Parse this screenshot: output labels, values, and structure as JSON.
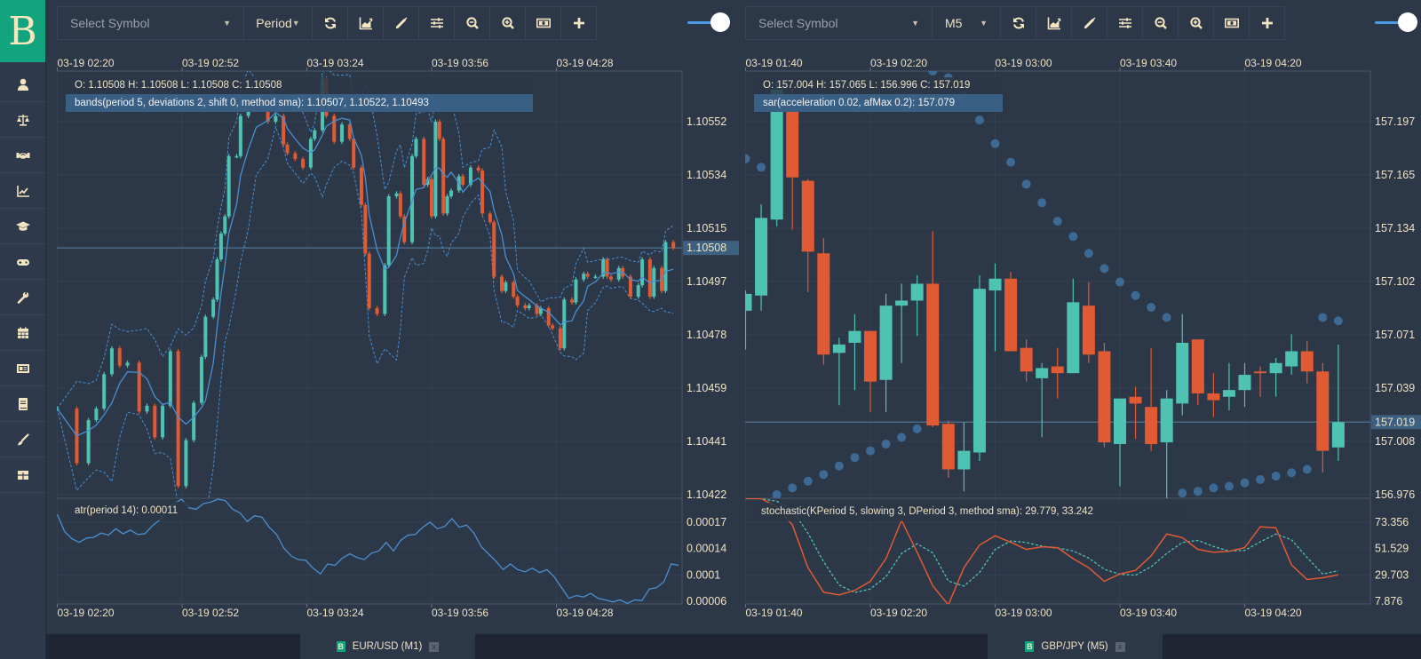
{
  "app": {
    "logo": "B",
    "text_color": "#efe3c4",
    "brand_color": "#12a47f"
  },
  "sidebar": {
    "items": [
      {
        "icon": "user-icon"
      },
      {
        "icon": "balance-scale-icon"
      },
      {
        "icon": "handshake-icon"
      },
      {
        "icon": "chart-line-icon"
      },
      {
        "icon": "graduation-cap-icon"
      },
      {
        "icon": "gamepad-icon"
      },
      {
        "icon": "wrench-icon"
      },
      {
        "icon": "calendar-icon"
      },
      {
        "icon": "newspaper-icon"
      },
      {
        "icon": "book-icon"
      },
      {
        "icon": "paint-brush-icon"
      },
      {
        "icon": "table-icon"
      }
    ]
  },
  "panes": [
    {
      "toolbar": {
        "symbol_placeholder": "Select Symbol",
        "period_label": "Period",
        "buttons": [
          "refresh-icon",
          "chart-area-icon",
          "pencil-icon",
          "sliders-icon",
          "zoom-out-icon",
          "zoom-in-icon",
          "money-icon",
          "plus-icon"
        ]
      },
      "ohlc_text": "O: 1.10508 H: 1.10508 L: 1.10508 C: 1.10508",
      "indicator_text": "bands(period 5, deviations 2, shift 0, method sma): 1.10507, 1.10522, 1.10493",
      "sub_indicator_text": "atr(period 14): 0.00011",
      "tab": {
        "label": "EUR/USD (M1)",
        "logo": "B",
        "close": "x"
      }
    },
    {
      "toolbar": {
        "symbol_placeholder": "Select Symbol",
        "period_label": "M5",
        "buttons": [
          "refresh-icon",
          "chart-area-icon",
          "pencil-icon",
          "sliders-icon",
          "zoom-out-icon",
          "zoom-in-icon",
          "money-icon",
          "plus-icon"
        ]
      },
      "ohlc_text": "O: 157.004 H: 157.065 L: 156.996 C: 157.019",
      "indicator_text": "sar(acceleration 0.02, afMax 0.2): 157.079",
      "sub_indicator_text": "stochastic(KPeriod 5, slowing 3, DPeriod 3, method sma): 29.779, 33.242",
      "tab": {
        "label": "GBP/JPY (M5)",
        "logo": "B",
        "close": "x"
      }
    }
  ],
  "chart_data": [
    {
      "type": "candlestick",
      "symbol": "EUR/USD",
      "timeframe": "M1",
      "colors": {
        "up": "#4ec3b3",
        "down": "#e05a33",
        "indicator": "#4a8fd1"
      },
      "x_ticks": [
        "03-19 02:20",
        "03-19 02:52",
        "03-19 03:24",
        "03-19 03:56",
        "03-19 04:28"
      ],
      "y_ticks": [
        "1.10552",
        "1.10534",
        "1.10515",
        "1.10497",
        "1.10478",
        "1.10459",
        "1.10441",
        "1.10422"
      ],
      "ylim": [
        1.10422,
        1.10552
      ],
      "current_price": "1.10508",
      "grid": true,
      "times": [
        "02:20",
        "02:25",
        "02:28",
        "02:30",
        "02:32",
        "02:34",
        "02:36",
        "02:38",
        "02:41",
        "02:43",
        "02:45",
        "02:47",
        "02:49",
        "02:51",
        "02:53",
        "02:55",
        "02:57",
        "02:58",
        "03:00",
        "03:01",
        "03:02",
        "03:03",
        "03:04",
        "03:06",
        "03:07",
        "03:09",
        "03:11",
        "03:14",
        "03:16",
        "03:18",
        "03:19",
        "03:21",
        "03:23",
        "03:25",
        "03:26",
        "03:28",
        "03:29",
        "03:31",
        "03:33",
        "03:35",
        "03:36",
        "03:38",
        "03:39",
        "03:40",
        "03:42",
        "03:44",
        "03:45",
        "03:47",
        "03:48",
        "03:49",
        "03:51",
        "03:52",
        "03:54",
        "03:55",
        "03:56",
        "03:57",
        "03:58",
        "03:59",
        "04:00",
        "04:01",
        "04:03",
        "04:04",
        "04:06",
        "04:08",
        "04:09",
        "04:11",
        "04:12",
        "04:14",
        "04:15",
        "04:17",
        "04:18",
        "04:20",
        "04:21",
        "04:23",
        "04:24",
        "04:26",
        "04:27",
        "04:29",
        "04:30",
        "04:32",
        "04:33",
        "04:35",
        "04:36",
        "04:38",
        "04:40",
        "04:41",
        "04:42",
        "04:44",
        "04:45",
        "04:47",
        "04:49",
        "04:50",
        "04:52",
        "04:53",
        "04:55",
        "04:56",
        "04:58"
      ],
      "close": [
        1.10452,
        1.10433,
        1.10448,
        1.10452,
        1.10464,
        1.10473,
        1.10467,
        1.10468,
        1.10451,
        1.10453,
        1.10442,
        1.10453,
        1.10472,
        1.10425,
        1.10441,
        1.10454,
        1.1047,
        1.10484,
        1.1049,
        1.10504,
        1.10513,
        1.10519,
        1.1054,
        1.1054,
        1.10554,
        1.10559,
        1.10557,
        1.10552,
        1.10554,
        1.10544,
        1.10541,
        1.10539,
        1.10536,
        1.10546,
        1.10549,
        1.10567,
        1.10554,
        1.10545,
        1.10551,
        1.10546,
        1.10536,
        1.10523,
        1.10506,
        1.10487,
        1.10485,
        1.10502,
        1.10526,
        1.10527,
        1.10519,
        1.1051,
        1.1054,
        1.10546,
        1.1053,
        1.10532,
        1.10519,
        1.10552,
        1.10546,
        1.1052,
        1.10526,
        1.10528,
        1.10533,
        1.1053,
        1.10536,
        1.10535,
        1.1052,
        1.10517,
        1.10498,
        1.10493,
        1.10496,
        1.10491,
        1.10488,
        1.10487,
        1.10488,
        1.10485,
        1.10487,
        1.10481,
        1.1048,
        1.10473,
        1.1049,
        1.10489,
        1.10497,
        1.10499,
        1.10498,
        1.10498,
        1.10504,
        1.10498,
        1.10497,
        1.10501,
        1.10498,
        1.10491,
        1.10495,
        1.10504,
        1.10491,
        1.10501,
        1.10493,
        1.1051,
        1.10508
      ],
      "indicator": {
        "name": "bands",
        "period": 5,
        "deviations": 2
      },
      "sub_chart": {
        "type": "line",
        "name": "atr",
        "period": 14,
        "y_ticks": [
          "0.00017",
          "0.00014",
          "0.0001",
          "0.00006"
        ],
        "ylim": [
          6e-05,
          0.00017
        ],
        "values": [
          0.000181,
          0.000157,
          0.000147,
          0.000142,
          0.000148,
          0.000149,
          0.000155,
          0.000152,
          0.000161,
          0.000154,
          0.000159,
          0.000153,
          0.000154,
          0.000165,
          0.000173,
          0.000188,
          0.000196,
          0.000202,
          0.00019,
          0.000188,
          0.000196,
          0.000198,
          0.000202,
          0.0002,
          0.000188,
          0.000183,
          0.000171,
          0.000179,
          0.000177,
          0.000163,
          0.000153,
          0.000134,
          0.000123,
          0.000118,
          0.000117,
          0.000106,
          9.8e-05,
          0.000112,
          0.00011,
          0.00012,
          0.000126,
          0.000121,
          0.000118,
          0.000127,
          0.00013,
          0.000142,
          0.00013,
          0.000145,
          0.000152,
          0.000153,
          0.000163,
          0.00017,
          0.000161,
          0.000164,
          0.000175,
          0.000163,
          0.000166,
          0.000155,
          0.000136,
          0.000126,
          0.000116,
          0.000104,
          0.000112,
          0.000104,
          0.000101,
          0.000106,
          0.0001,
          0.000104,
          9.4e-05,
          7.9e-05,
          6.4e-05,
          6.8e-05,
          6.6e-05,
          7.1e-05,
          6.4e-05,
          6.2e-05,
          5.9e-05,
          6.2e-05,
          5.7e-05,
          6.2e-05,
          6.1e-05,
          7.7e-05,
          7.9e-05,
          8.7e-05,
          0.000112,
          0.00011
        ]
      }
    },
    {
      "type": "candlestick",
      "symbol": "GBP/JPY",
      "timeframe": "M5",
      "colors": {
        "up": "#4ec3b3",
        "down": "#e05a33",
        "sar": "#3d6a94",
        "stoch_k": "#e05a33",
        "stoch_d": "#4ec3b3"
      },
      "x_ticks": [
        "03-19 01:40",
        "03-19 02:20",
        "03-19 03:00",
        "03-19 03:40",
        "03-19 04:20"
      ],
      "y_ticks": [
        "157.197",
        "157.165",
        "157.134",
        "157.102",
        "157.071",
        "157.039",
        "157.008",
        "156.976"
      ],
      "ylim": [
        156.976,
        157.197
      ],
      "current_price": "157.019",
      "grid": true,
      "candles_columns": [
        "time",
        "open",
        "high",
        "low",
        "close"
      ],
      "candles": [
        [
          "01:40",
          157.085,
          157.097,
          157.062,
          157.095
        ],
        [
          "01:45",
          157.094,
          157.148,
          157.085,
          157.14
        ],
        [
          "01:50",
          157.139,
          157.22,
          157.135,
          157.216
        ],
        [
          "01:55",
          157.211,
          157.217,
          157.133,
          157.164
        ],
        [
          "02:00",
          157.162,
          157.163,
          157.096,
          157.12
        ],
        [
          "02:05",
          157.119,
          157.128,
          157.053,
          157.059
        ],
        [
          "02:10",
          157.06,
          157.069,
          157.029,
          157.065
        ],
        [
          "02:15",
          157.066,
          157.083,
          157.038,
          157.073
        ],
        [
          "02:20",
          157.073,
          157.073,
          157.025,
          157.043
        ],
        [
          "02:25",
          157.044,
          157.095,
          157.025,
          157.088
        ],
        [
          "02:30",
          157.088,
          157.101,
          157.054,
          157.091
        ],
        [
          "02:35",
          157.091,
          157.106,
          157.07,
          157.101
        ],
        [
          "02:40",
          157.101,
          157.132,
          157.016,
          157.017
        ],
        [
          "02:45",
          157.018,
          157.02,
          156.986,
          156.991
        ],
        [
          "02:50",
          156.991,
          157.019,
          156.978,
          157.002
        ],
        [
          "02:55",
          157.001,
          157.106,
          156.996,
          157.098
        ],
        [
          "03:00",
          157.097,
          157.113,
          157.061,
          157.104
        ],
        [
          "03:05",
          157.104,
          157.108,
          157.061,
          157.061
        ],
        [
          "03:10",
          157.063,
          157.068,
          157.043,
          157.049
        ],
        [
          "03:15",
          157.045,
          157.054,
          157.01,
          157.051
        ],
        [
          "03:20",
          157.052,
          157.063,
          157.033,
          157.048
        ],
        [
          "03:25",
          157.048,
          157.104,
          157.048,
          157.09
        ],
        [
          "03:30",
          157.088,
          157.102,
          157.054,
          157.059
        ],
        [
          "03:35",
          157.061,
          157.066,
          157.004,
          157.007
        ],
        [
          "03:40",
          157.006,
          157.033,
          156.981,
          157.033
        ],
        [
          "03:45",
          157.034,
          157.04,
          157.009,
          157.03
        ],
        [
          "03:50",
          157.028,
          157.063,
          157.002,
          157.006
        ],
        [
          "03:55",
          157.007,
          157.038,
          156.973,
          157.033
        ],
        [
          "04:00",
          157.03,
          157.083,
          157.023,
          157.066
        ],
        [
          "04:05",
          157.068,
          157.068,
          157.029,
          157.036
        ],
        [
          "04:10",
          157.036,
          157.048,
          157.022,
          157.032
        ],
        [
          "04:15",
          157.034,
          157.054,
          157.026,
          157.038
        ],
        [
          "04:20",
          157.038,
          157.054,
          157.028,
          157.047
        ],
        [
          "04:25",
          157.049,
          157.052,
          157.034,
          157.048
        ],
        [
          "04:30",
          157.048,
          157.057,
          157.034,
          157.054
        ],
        [
          "04:35",
          157.052,
          157.071,
          157.047,
          157.061
        ],
        [
          "04:40",
          157.061,
          157.067,
          157.042,
          157.049
        ],
        [
          "04:45",
          157.049,
          157.054,
          156.989,
          157.002
        ],
        [
          "04:50",
          157.004,
          157.065,
          156.996,
          157.019
        ]
      ],
      "indicator": {
        "name": "sar",
        "acceleration": 0.02,
        "afMax": 0.2,
        "values": [
          157.175,
          157.17,
          156.976,
          156.98,
          156.984,
          156.988,
          156.993,
          156.998,
          157.002,
          157.006,
          157.01,
          157.015,
          157.227,
          157.223,
          157.212,
          157.198,
          157.184,
          157.173,
          157.16,
          157.149,
          157.138,
          157.129,
          157.119,
          157.11,
          157.102,
          157.094,
          157.087,
          157.081,
          156.977,
          156.978,
          156.98,
          156.981,
          156.983,
          156.985,
          156.987,
          156.989,
          156.991,
          157.081,
          157.079
        ]
      },
      "sub_chart": {
        "type": "line",
        "name": "stochastic",
        "y_ticks": [
          "73.356",
          "51.529",
          "29.703",
          "7.876"
        ],
        "ylim": [
          7.876,
          73.356
        ],
        "k": [
          92.9,
          92.9,
          86.2,
          71.1,
          35.7,
          15.4,
          13.1,
          16.9,
          24.4,
          43.2,
          74.9,
          48.5,
          20.7,
          4.9,
          35.7,
          54.5,
          62.1,
          56.8,
          50.8,
          53.0,
          52.3,
          43.2,
          35.7,
          24.4,
          30.5,
          33.5,
          45.5,
          63.6,
          60.6,
          50.8,
          48.5,
          49.3,
          52.3,
          69.6,
          68.8,
          38.0,
          25.9,
          27.4,
          29.779
        ],
        "d": [
          92.9,
          92.9,
          90.7,
          83.4,
          64.3,
          40.7,
          21.4,
          15.1,
          18.1,
          28.2,
          47.5,
          55.5,
          48.0,
          24.7,
          20.4,
          31.7,
          50.8,
          57.8,
          56.6,
          53.5,
          52.0,
          49.5,
          43.7,
          34.4,
          30.2,
          29.5,
          36.5,
          47.5,
          56.6,
          58.3,
          53.3,
          49.5,
          50.0,
          57.1,
          63.6,
          58.8,
          44.2,
          30.4,
          33.242
        ]
      }
    }
  ]
}
